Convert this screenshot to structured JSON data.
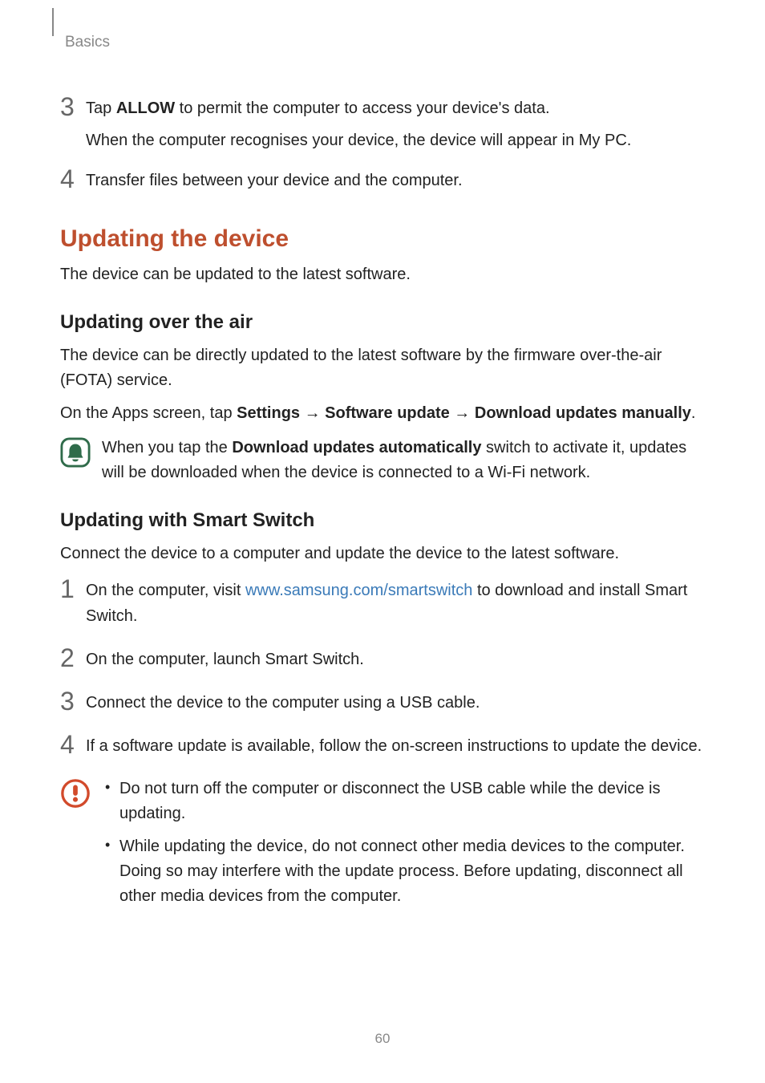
{
  "header": {
    "breadcrumb": "Basics"
  },
  "topSteps": [
    {
      "num": "3",
      "parts": [
        {
          "type": "plain",
          "text": "Tap "
        },
        {
          "type": "bold",
          "text": "ALLOW"
        },
        {
          "type": "plain",
          "text": " to permit the computer to access your device's data."
        }
      ],
      "sub": "When the computer recognises your device, the device will appear in My PC."
    },
    {
      "num": "4",
      "parts": [
        {
          "type": "plain",
          "text": "Transfer files between your device and the computer."
        }
      ]
    }
  ],
  "section1": {
    "heading": "Updating the device",
    "intro": "The device can be updated to the latest software."
  },
  "sub1": {
    "heading": "Updating over the air",
    "para1": "The device can be directly updated to the latest software by the firmware over-the-air (FOTA) service.",
    "para2_parts": [
      {
        "type": "plain",
        "text": "On the Apps screen, tap "
      },
      {
        "type": "bold",
        "text": "Settings"
      },
      {
        "type": "plain",
        "text": " → "
      },
      {
        "type": "bold",
        "text": "Software update"
      },
      {
        "type": "plain",
        "text": " → "
      },
      {
        "type": "bold",
        "text": "Download updates manually"
      },
      {
        "type": "plain",
        "text": "."
      }
    ],
    "note_parts": [
      {
        "type": "plain",
        "text": "When you tap the "
      },
      {
        "type": "bold",
        "text": "Download updates automatically"
      },
      {
        "type": "plain",
        "text": " switch to activate it, updates will be downloaded when the device is connected to a Wi-Fi network."
      }
    ]
  },
  "sub2": {
    "heading": "Updating with Smart Switch",
    "intro": "Connect the device to a computer and update the device to the latest software.",
    "steps": [
      {
        "num": "1",
        "parts": [
          {
            "type": "plain",
            "text": "On the computer, visit "
          },
          {
            "type": "link",
            "text": "www.samsung.com/smartswitch"
          },
          {
            "type": "plain",
            "text": " to download and install Smart Switch."
          }
        ]
      },
      {
        "num": "2",
        "parts": [
          {
            "type": "plain",
            "text": "On the computer, launch Smart Switch."
          }
        ]
      },
      {
        "num": "3",
        "parts": [
          {
            "type": "plain",
            "text": "Connect the device to the computer using a USB cable."
          }
        ]
      },
      {
        "num": "4",
        "parts": [
          {
            "type": "plain",
            "text": "If a software update is available, follow the on-screen instructions to update the device."
          }
        ]
      }
    ],
    "cautions": [
      "Do not turn off the computer or disconnect the USB cable while the device is updating.",
      "While updating the device, do not connect other media devices to the computer. Doing so may interfere with the update process. Before updating, disconnect all other media devices from the computer."
    ]
  },
  "pageNum": "60",
  "icons": {
    "note": "note-bell-icon",
    "caution": "caution-exclamation-icon"
  }
}
